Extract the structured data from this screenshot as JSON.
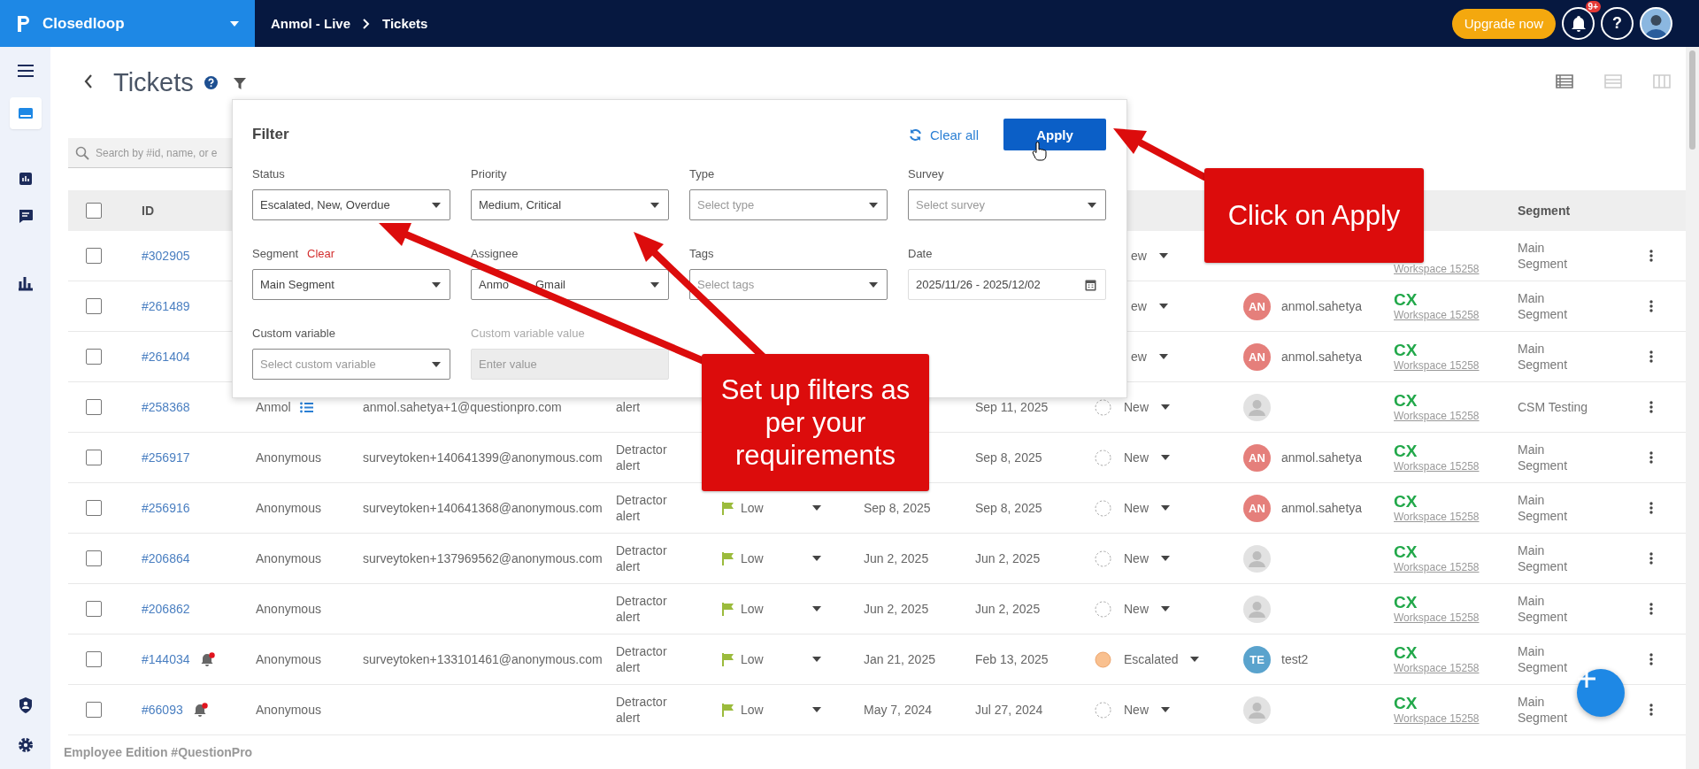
{
  "topbar": {
    "brand": "Closedloop",
    "breadcrumb": [
      "Anmol - Live",
      "Tickets"
    ],
    "upgrade": "Upgrade now",
    "notification_badge": "9+",
    "help": "?"
  },
  "sidebar": {
    "items": [
      {
        "kind": "menu",
        "selected": false
      },
      {
        "kind": "tickets",
        "selected": true
      },
      {
        "kind": "reports",
        "selected": false
      },
      {
        "kind": "messages",
        "selected": false
      },
      {
        "kind": "analytics",
        "selected": false
      },
      {
        "kind": "roles",
        "selected": false
      },
      {
        "kind": "settings",
        "selected": false
      }
    ]
  },
  "page": {
    "title": "Tickets",
    "search": {
      "placeholder": "Search by #id, name, or e"
    },
    "view_modes": [
      {
        "kind": "list",
        "selected": true
      },
      {
        "kind": "split",
        "selected": false
      },
      {
        "kind": "board",
        "selected": false
      }
    ]
  },
  "table": {
    "header": {
      "id": "ID",
      "segment": "Segment",
      "checked": false
    },
    "rows": [
      {
        "id": "#302905",
        "checked": false,
        "alert": false,
        "list_icon": false,
        "status": {
          "label": "ew",
          "kind": "cut"
        },
        "app": {
          "workspace": "Workspace 15258"
        },
        "segment": "Main Segment"
      },
      {
        "id": "#261489",
        "checked": false,
        "alert": false,
        "list_icon": false,
        "status": {
          "label": "ew",
          "kind": "cut"
        },
        "assignee": {
          "kind": "initials",
          "initials": "AN",
          "color": "#e57f7b",
          "name": "anmol.sahetya"
        },
        "app": {
          "label": "CX",
          "workspace": "Workspace 15258"
        },
        "segment": "Main Segment"
      },
      {
        "id": "#261404",
        "checked": false,
        "alert": false,
        "list_icon": false,
        "status": {
          "label": "ew",
          "kind": "cut"
        },
        "assignee": {
          "kind": "initials",
          "initials": "AN",
          "color": "#e57f7b",
          "name": "anmol.sahetya"
        },
        "app": {
          "label": "CX",
          "workspace": "Workspace 15258"
        },
        "segment": "Main Segment"
      },
      {
        "id": "#258368",
        "checked": false,
        "alert": false,
        "list_icon": true,
        "name": "Anmol",
        "email": "anmol.sahetya+1@questionpro.com",
        "type": "alert",
        "date2": "Sep 11, 2025",
        "status": {
          "label": "New",
          "kind": "new"
        },
        "assignee": {
          "kind": "none"
        },
        "app": {
          "label": "CX",
          "workspace": "Workspace 15258"
        },
        "segment": "CSM Testing"
      },
      {
        "id": "#256917",
        "checked": false,
        "alert": false,
        "list_icon": false,
        "name": "Anonymous",
        "email": "surveytoken+140641399@anonymous.com",
        "type": "Detractor alert",
        "date2": "Sep 8, 2025",
        "status": {
          "label": "New",
          "kind": "new"
        },
        "assignee": {
          "kind": "initials",
          "initials": "AN",
          "color": "#e57f7b",
          "name": "anmol.sahetya"
        },
        "app": {
          "label": "CX",
          "workspace": "Workspace 15258"
        },
        "segment": "Main Segment"
      },
      {
        "id": "#256916",
        "checked": false,
        "alert": false,
        "list_icon": false,
        "name": "Anonymous",
        "email": "surveytoken+140641368@anonymous.com",
        "type": "Detractor alert",
        "priority": {
          "label": "Low",
          "kind": "low"
        },
        "date1": "Sep 8, 2025",
        "date2": "Sep 8, 2025",
        "status": {
          "label": "New",
          "kind": "new"
        },
        "assignee": {
          "kind": "initials",
          "initials": "AN",
          "color": "#e57f7b",
          "name": "anmol.sahetya"
        },
        "app": {
          "label": "CX",
          "workspace": "Workspace 15258"
        },
        "segment": "Main Segment"
      },
      {
        "id": "#206864",
        "checked": false,
        "alert": false,
        "list_icon": false,
        "name": "Anonymous",
        "email": "surveytoken+137969562@anonymous.com",
        "type": "Detractor alert",
        "priority": {
          "label": "Low",
          "kind": "low"
        },
        "date1": "Jun 2, 2025",
        "date2": "Jun 2, 2025",
        "status": {
          "label": "New",
          "kind": "new"
        },
        "assignee": {
          "kind": "none"
        },
        "app": {
          "label": "CX",
          "workspace": "Workspace 15258"
        },
        "segment": "Main Segment"
      },
      {
        "id": "#206862",
        "checked": false,
        "alert": false,
        "list_icon": false,
        "name": "Anonymous",
        "type": "Detractor alert",
        "priority": {
          "label": "Low",
          "kind": "low"
        },
        "date1": "Jun 2, 2025",
        "date2": "Jun 2, 2025",
        "status": {
          "label": "New",
          "kind": "new"
        },
        "assignee": {
          "kind": "none"
        },
        "app": {
          "label": "CX",
          "workspace": "Workspace 15258"
        },
        "segment": "Main Segment"
      },
      {
        "id": "#144034",
        "checked": false,
        "alert": true,
        "list_icon": false,
        "name": "Anonymous",
        "email": "surveytoken+133101461@anonymous.com",
        "type": "Detractor alert",
        "priority": {
          "label": "Low",
          "kind": "low"
        },
        "date1": "Jan 21, 2025",
        "date2": "Feb 13, 2025",
        "status": {
          "label": "Escalated",
          "kind": "escalated"
        },
        "assignee": {
          "kind": "initials",
          "initials": "TE",
          "color": "#5aa3cd",
          "name": "test2"
        },
        "app": {
          "label": "CX",
          "workspace": "Workspace 15258"
        },
        "segment": "Main Segment"
      },
      {
        "id": "#66093",
        "checked": false,
        "alert": true,
        "list_icon": false,
        "name": "Anonymous",
        "type": "Detractor alert",
        "priority": {
          "label": "Low",
          "kind": "low"
        },
        "date1": "May 7, 2024",
        "date2": "Jul 27, 2024",
        "status": {
          "label": "New",
          "kind": "new"
        },
        "assignee": {
          "kind": "none"
        },
        "app": {
          "label": "CX",
          "workspace": "Workspace 15258"
        },
        "segment": "Main Segment"
      }
    ]
  },
  "footer": "Employee Edition #QuestionPro",
  "filter": {
    "title": "Filter",
    "clear_all": "Clear all",
    "apply": "Apply",
    "fields": [
      {
        "label": "Status",
        "kind": "select",
        "value": "Escalated, New, Overdue",
        "disabled": false
      },
      {
        "label": "Priority",
        "kind": "select",
        "value": "Medium, Critical",
        "disabled": false
      },
      {
        "label": "Type",
        "kind": "select",
        "placeholder": "Select type",
        "disabled": false
      },
      {
        "label": "Survey",
        "kind": "select",
        "placeholder": "Select survey",
        "disabled": false
      },
      {
        "label": "Segment",
        "clear": "Clear",
        "kind": "select",
        "value": "Main Segment",
        "disabled": false
      },
      {
        "label": "Assignee",
        "kind": "select",
        "value_parts": [
          "Anmo",
          "Gmail"
        ],
        "disabled": false
      },
      {
        "label": "Tags",
        "kind": "select",
        "placeholder": "Select tags",
        "disabled": false
      },
      {
        "label": "Date",
        "kind": "date",
        "value": "2025/11/26 - 2025/12/02",
        "disabled": false
      },
      {
        "label": "Custom variable",
        "kind": "select",
        "placeholder": "Select custom variable",
        "disabled": false
      },
      {
        "label": "Custom variable value",
        "kind": "text",
        "placeholder": "Enter value",
        "disabled": true
      }
    ]
  },
  "annotations": [
    {
      "text": "Set up filters as per your requirements"
    },
    {
      "text": "Click on Apply"
    }
  ]
}
